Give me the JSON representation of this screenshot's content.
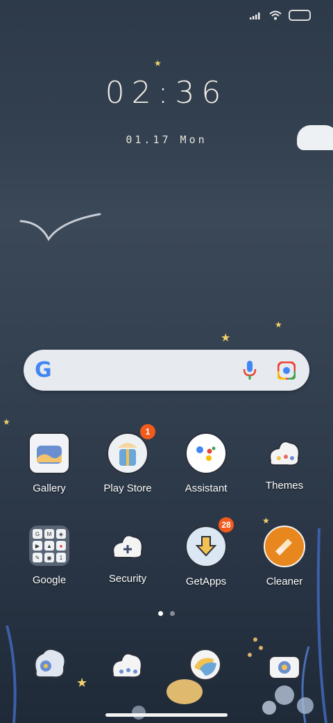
{
  "status": {
    "icons": [
      "signal-icon",
      "wifi-icon",
      "battery-icon"
    ]
  },
  "clock": {
    "time": "02:36",
    "date": "01.17 Mon"
  },
  "search": {
    "logo": "G",
    "icons": [
      "mic-icon",
      "lens-icon"
    ]
  },
  "apps_row1": [
    {
      "label": "Gallery",
      "icon": "gallery-icon"
    },
    {
      "label": "Play Store",
      "icon": "play-store-icon",
      "badge": "1"
    },
    {
      "label": "Assistant",
      "icon": "assistant-icon"
    },
    {
      "label": "Themes",
      "icon": "themes-icon"
    }
  ],
  "apps_row2": [
    {
      "label": "Google",
      "icon": "google-folder-icon"
    },
    {
      "label": "Security",
      "icon": "security-icon"
    },
    {
      "label": "GetApps",
      "icon": "getapps-icon",
      "badge": "28"
    },
    {
      "label": "Cleaner",
      "icon": "cleaner-icon"
    }
  ],
  "dock": [
    {
      "icon": "phone-icon"
    },
    {
      "icon": "messages-icon"
    },
    {
      "icon": "browser-icon"
    },
    {
      "icon": "camera-icon"
    }
  ],
  "pages": {
    "count": 2,
    "active": 1
  },
  "colors": {
    "badge": "#f25b1c",
    "accent_star": "#f3d36b",
    "cleaner": "#e8871e"
  }
}
